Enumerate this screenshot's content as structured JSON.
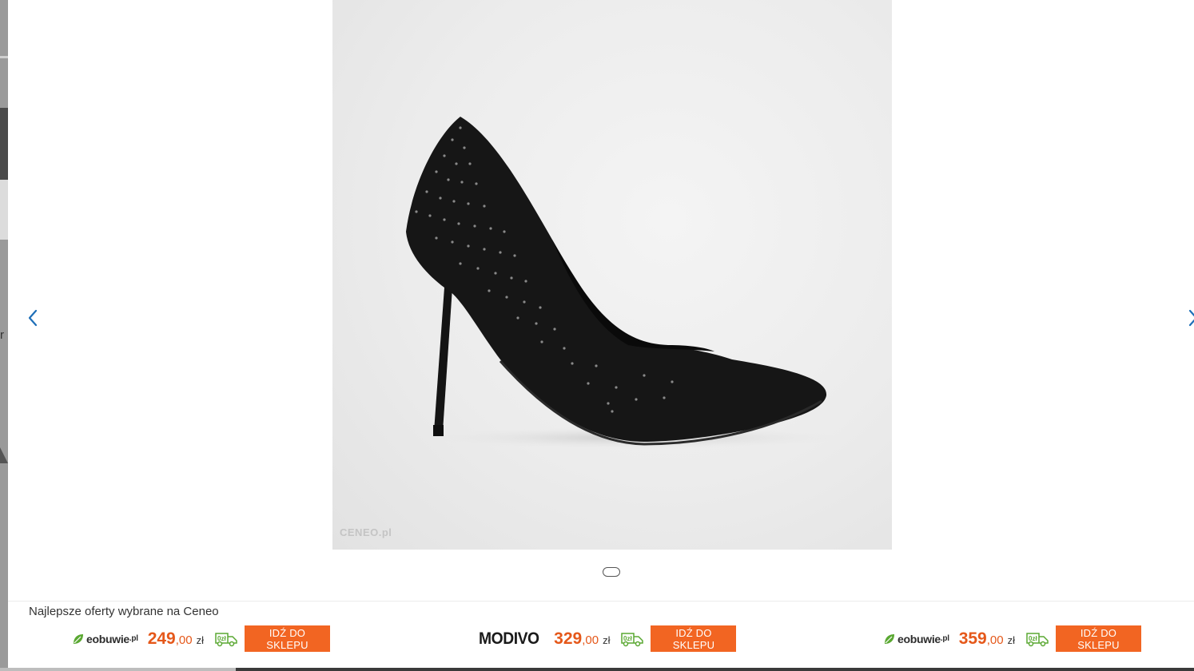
{
  "gallery": {
    "watermark": "CENEO.pl",
    "prev_label": "previous-image",
    "next_label": "next-image",
    "image_subject": "black stiletto pump"
  },
  "offers": {
    "heading": "Najlepsze oferty wybrane na Ceneo",
    "items": [
      {
        "shop": "eobuwie",
        "shop_suffix": ".pl",
        "price_int": "249",
        "price_dec": ",00",
        "currency": "zł",
        "delivery_badge": "0zł",
        "button": "IDŹ DO SKLEPU"
      },
      {
        "shop": "MODIVO",
        "price_int": "329",
        "price_dec": ",00",
        "currency": "zł",
        "delivery_badge": "0zł",
        "button": "IDŹ DO SKLEPU"
      },
      {
        "shop": "eobuwie",
        "shop_suffix": ".pl",
        "price_int": "359",
        "price_dec": ",00",
        "currency": "zł",
        "delivery_badge": "0zł",
        "button": "IDŹ DO SKLEPU"
      }
    ]
  },
  "colors": {
    "accent": "#f26522",
    "price": "#e5581a",
    "delivery_green": "#5aa832",
    "nav_blue": "#1e6fb8"
  }
}
